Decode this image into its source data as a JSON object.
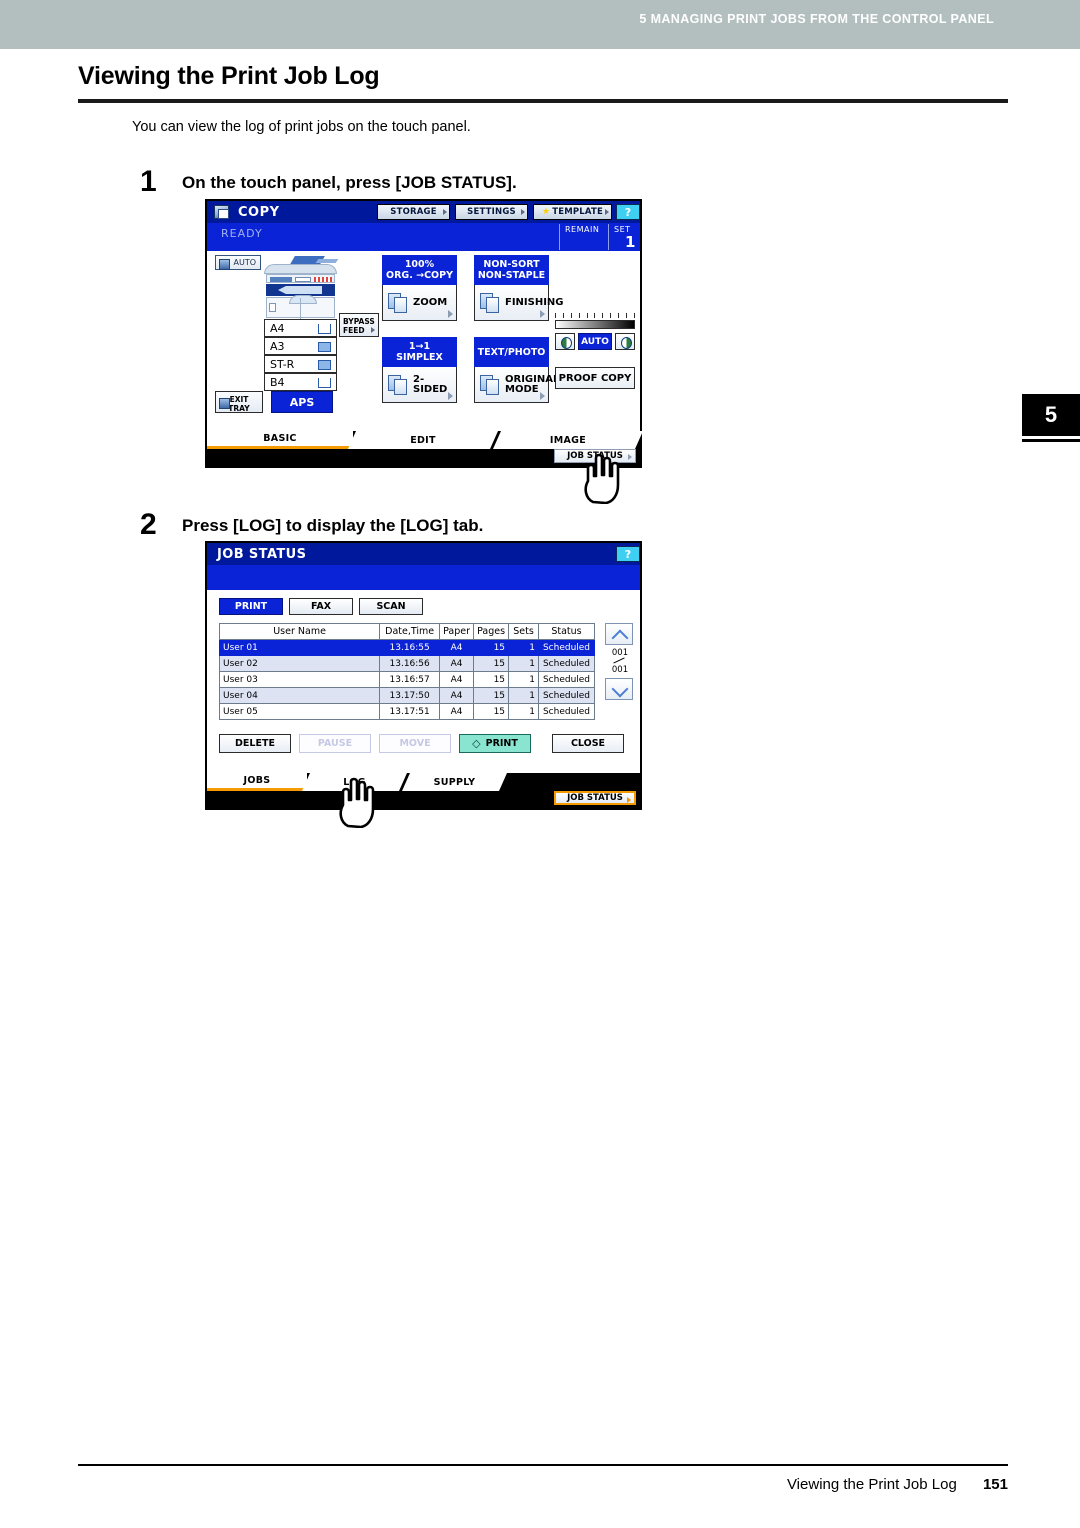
{
  "running_head": "5 MANAGING PRINT JOBS FROM THE CONTROL PANEL",
  "chapter_tab": "5",
  "page_title": "Viewing the Print Job Log",
  "intro": "You can view the log of print jobs on the touch panel.",
  "steps": [
    {
      "number": "1",
      "text": "On the touch panel, press [JOB STATUS]."
    },
    {
      "number": "2",
      "text": "Press [LOG] to display the [LOG] tab."
    }
  ],
  "copy_screen": {
    "title": "COPY",
    "header_buttons": [
      "STORAGE",
      "SETTINGS",
      "TEMPLATE"
    ],
    "help_label": "?",
    "status": "READY",
    "remain_label": "REMAIN",
    "set_label": "SET",
    "set_value": "1",
    "auto_chip": "AUTO",
    "paper_sizes": [
      "A4",
      "A3",
      "ST-R",
      "B4"
    ],
    "bypass_feed": "BYPASS\nFEED",
    "bypass_line1": "BYPASS",
    "bypass_line2": "FEED",
    "exit_tray_line1": "EXIT",
    "exit_tray_line2": "TRAY",
    "aps": "APS",
    "functions": [
      {
        "cap_line1": "100%",
        "cap_line2": "ORG.  →COPY",
        "label": "ZOOM"
      },
      {
        "cap_line1": "NON-SORT",
        "cap_line2": "NON-STAPLE",
        "label": "FINISHING"
      },
      {
        "cap_line1": "1→1",
        "cap_line2": "SIMPLEX",
        "label": "2-SIDED"
      },
      {
        "cap_line1": "TEXT/PHOTO",
        "cap_line2": "",
        "label": "ORIGINAL MODE"
      }
    ],
    "density_auto": "AUTO",
    "proof_copy": "PROOF COPY",
    "tabs": [
      "BASIC",
      "EDIT",
      "IMAGE"
    ],
    "job_status_button": "JOB STATUS"
  },
  "jobstatus_screen": {
    "title": "JOB STATUS",
    "help_label": "?",
    "mode_buttons": [
      "PRINT",
      "FAX",
      "SCAN"
    ],
    "table": {
      "headers": [
        "User Name",
        "Date,Time",
        "Paper",
        "Pages",
        "Sets",
        "Status"
      ],
      "rows": [
        {
          "user": "User 01",
          "datetime": "13.16:55",
          "paper": "A4",
          "pages": "15",
          "sets": "1",
          "status": "Scheduled"
        },
        {
          "user": "User 02",
          "datetime": "13.16:56",
          "paper": "A4",
          "pages": "15",
          "sets": "1",
          "status": "Scheduled"
        },
        {
          "user": "User 03",
          "datetime": "13.16:57",
          "paper": "A4",
          "pages": "15",
          "sets": "1",
          "status": "Scheduled"
        },
        {
          "user": "User 04",
          "datetime": "13.17:50",
          "paper": "A4",
          "pages": "15",
          "sets": "1",
          "status": "Scheduled"
        },
        {
          "user": "User 05",
          "datetime": "13.17:51",
          "paper": "A4",
          "pages": "15",
          "sets": "1",
          "status": "Scheduled"
        }
      ]
    },
    "scroll_current": "001",
    "scroll_total": "001",
    "action_buttons": [
      "DELETE",
      "PAUSE",
      "MOVE",
      "PRINT",
      "CLOSE"
    ],
    "tabs": [
      "JOBS",
      "LOG",
      "SUPPLY"
    ],
    "job_status_button": "JOB STATUS"
  },
  "footer": {
    "text": "Viewing the Print Job Log",
    "page": "151"
  },
  "colors": {
    "band": "#b3bfbf",
    "lcd_title": "#00189c",
    "lcd_blue": "#0b23d6",
    "accent_orange": "#f59a00",
    "help_cyan": "#3ecff2",
    "print_green": "#8ae5d0"
  }
}
